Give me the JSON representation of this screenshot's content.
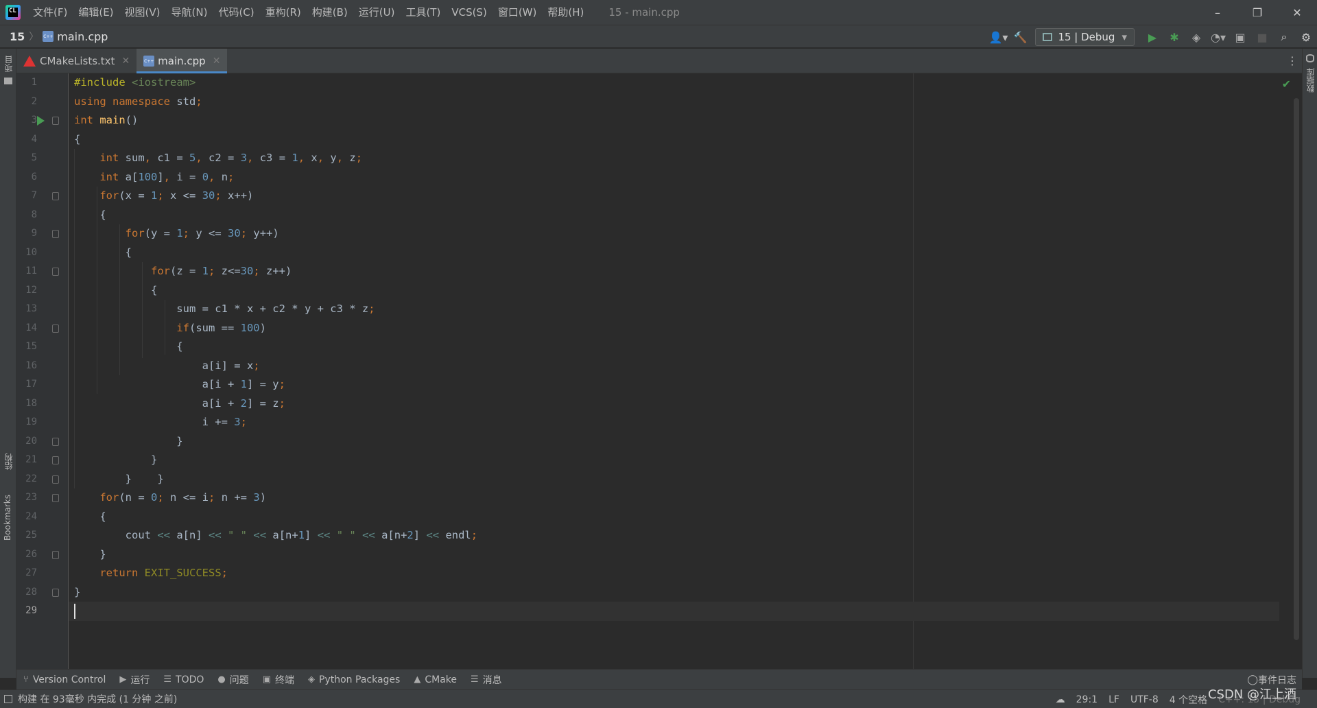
{
  "titlebar": {
    "logo_text": "CL",
    "menu": [
      "文件(F)",
      "编辑(E)",
      "视图(V)",
      "导航(N)",
      "代码(C)",
      "重构(R)",
      "构建(B)",
      "运行(U)",
      "工具(T)",
      "VCS(S)",
      "窗口(W)",
      "帮助(H)"
    ],
    "window_title": "15 - main.cpp",
    "controls": {
      "minimize": "–",
      "restore": "❐",
      "close": "✕"
    }
  },
  "navbar": {
    "project": "15",
    "file": "main.cpp",
    "run_config": "15 | Debug"
  },
  "left_strip": {
    "top_label": "项目",
    "mid_label": "结构",
    "bottom_label": "Bookmarks"
  },
  "right_strip": {
    "label": "数据库"
  },
  "tabs": [
    {
      "label": "CMakeLists.txt",
      "active": false
    },
    {
      "label": "main.cpp",
      "active": true
    }
  ],
  "editor": {
    "current_line": 29,
    "line_numbers": [
      "1",
      "2",
      "3",
      "4",
      "5",
      "6",
      "7",
      "8",
      "9",
      "10",
      "11",
      "12",
      "13",
      "14",
      "15",
      "16",
      "17",
      "18",
      "19",
      "20",
      "21",
      "22",
      "23",
      "24",
      "25",
      "26",
      "27",
      "28",
      "29"
    ]
  },
  "bottom_tools": [
    {
      "icon": "vcs-icon",
      "label": "Version Control"
    },
    {
      "icon": "run-icon",
      "label": "运行"
    },
    {
      "icon": "todo-icon",
      "label": "TODO"
    },
    {
      "icon": "problems-icon",
      "label": "问题"
    },
    {
      "icon": "terminal-icon",
      "label": "终端"
    },
    {
      "icon": "python-packages-icon",
      "label": "Python Packages"
    },
    {
      "icon": "cmake-icon",
      "label": "CMake"
    },
    {
      "icon": "messages-icon",
      "label": "消息"
    }
  ],
  "event_log": "事件日志",
  "statusbar": {
    "message": "构建 在 93毫秒 内完成 (1 分钟 之前)",
    "position": "29:1",
    "line_sep": "LF",
    "encoding": "UTF-8",
    "indent": "4 个空格",
    "context": "C++: 15 | Debug"
  },
  "watermark": "CSDN @江上酒"
}
